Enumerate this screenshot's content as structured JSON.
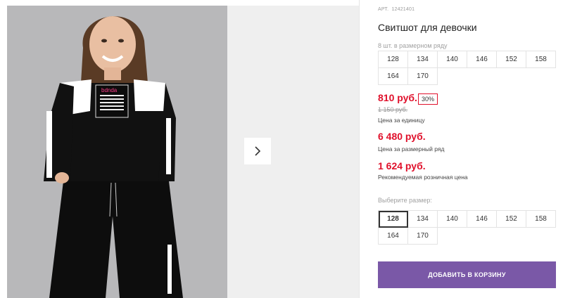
{
  "product": {
    "article_label": "АРТ.",
    "article_number": "12421401",
    "title": "Свитшот для девочки",
    "row_note": "8 шт. в размерном ряду",
    "size_row": [
      "128",
      "134",
      "140",
      "146",
      "152",
      "158",
      "164",
      "170"
    ],
    "price": "810 руб.",
    "discount_badge": "30%",
    "old_price": "1 150 руб.",
    "price_unit_note": "Цена за единицу",
    "row_price": "6 480 руб.",
    "row_price_note": "Цена за размерный ряд",
    "retail_price": "1 624 руб.",
    "retail_price_note": "Рекомендуемая розничная цена",
    "choose_size_label": "Выберите размер:",
    "size_options": [
      "128",
      "134",
      "140",
      "146",
      "152",
      "158",
      "164",
      "170"
    ],
    "selected_size": "128",
    "add_to_cart": "ДОБАВИТЬ В КОРЗИНУ"
  },
  "gallery": {
    "next_icon": "chevron-right-icon",
    "photo_print_text": "bdnda"
  },
  "colors": {
    "price_red": "#e0102b",
    "button_purple": "#7a58a7",
    "print_pink": "#ff3d8b"
  }
}
